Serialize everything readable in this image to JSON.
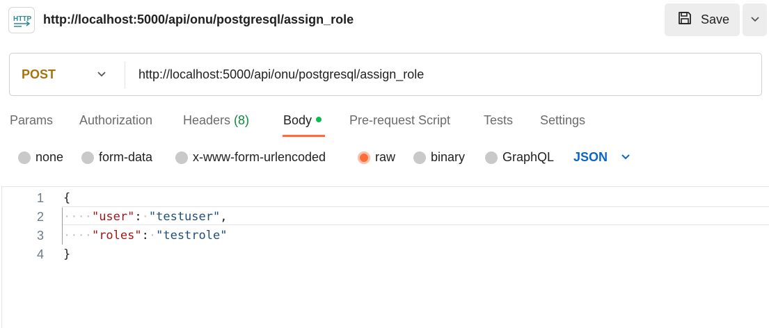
{
  "header": {
    "icon": "http-icon",
    "title": "http://localhost:5000/api/onu/postgresql/assign_role",
    "save_label": "Save"
  },
  "request": {
    "method": "POST",
    "url": "http://localhost:5000/api/onu/postgresql/assign_role"
  },
  "tabs": [
    {
      "label": "Params"
    },
    {
      "label": "Authorization"
    },
    {
      "label": "Headers ",
      "count": "(8)"
    },
    {
      "label": "Body",
      "active": true
    },
    {
      "label": "Pre-request Script"
    },
    {
      "label": "Tests"
    },
    {
      "label": "Settings"
    }
  ],
  "body_types": [
    {
      "label": "none"
    },
    {
      "label": "form-data"
    },
    {
      "label": "x-www-form-urlencoded"
    },
    {
      "label": "raw",
      "selected": true
    },
    {
      "label": "binary"
    },
    {
      "label": "GraphQL"
    }
  ],
  "format": "JSON",
  "editor": {
    "lines": [
      {
        "num": "1",
        "open": "{"
      },
      {
        "num": "2",
        "key": "\"user\"",
        "colon": ":",
        "value": "\"testuser\"",
        "comma": ","
      },
      {
        "num": "3",
        "key": "\"roles\"",
        "colon": ":",
        "value": "\"testrole\"",
        "comma": ""
      },
      {
        "num": "4",
        "close": "}"
      }
    ]
  },
  "colors": {
    "accent": "#ff6c37",
    "method": "#a6740f",
    "json_link": "#0d64c8",
    "active_dot": "#0cbb52"
  }
}
